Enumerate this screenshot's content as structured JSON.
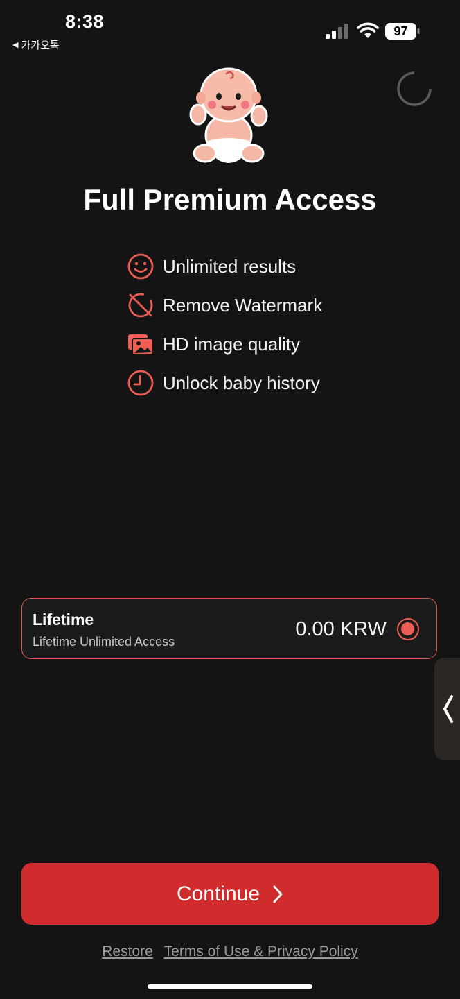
{
  "status_bar": {
    "time": "8:38",
    "back_app": "카카오톡",
    "battery": "97"
  },
  "paywall": {
    "title": "Full Premium Access",
    "features": [
      {
        "icon": "smile-icon",
        "label": "Unlimited results"
      },
      {
        "icon": "no-watermark-icon",
        "label": "Remove Watermark"
      },
      {
        "icon": "images-icon",
        "label": "HD image quality"
      },
      {
        "icon": "clock-icon",
        "label": "Unlock baby history"
      }
    ]
  },
  "plan": {
    "name": "Lifetime",
    "description": "Lifetime Unlimited Access",
    "price": "0.00 KRW",
    "selected": true
  },
  "actions": {
    "continue_label": "Continue",
    "restore_label": "Restore",
    "terms_label": "Terms of Use & Privacy Policy"
  },
  "colors": {
    "background": "#141414",
    "accent": "#ec5e53",
    "button": "#d02c2d"
  }
}
